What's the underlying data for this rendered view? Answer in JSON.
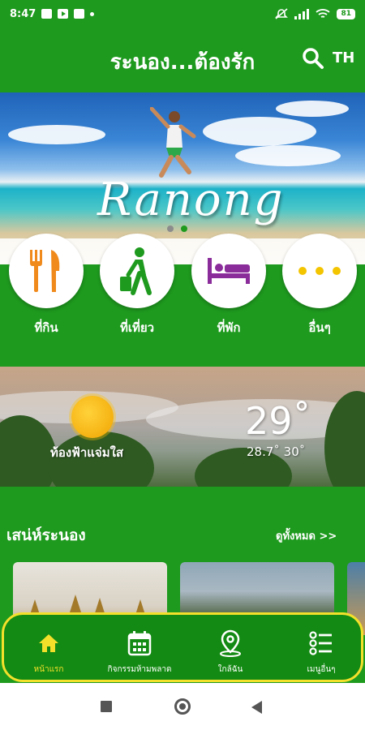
{
  "status_bar": {
    "time": "8:47",
    "battery": "81"
  },
  "header": {
    "title": "ระนอง...ต้องรัก",
    "lang": "TH"
  },
  "hero": {
    "title": "Ranong",
    "slide_index": 2,
    "slide_count": 2
  },
  "categories": [
    {
      "label": "ที่กิน",
      "icon": "fork-knife-icon",
      "color": "#f08a1c"
    },
    {
      "label": "ที่เที่ยว",
      "icon": "traveler-icon",
      "color": "#1e9a1e"
    },
    {
      "label": "ที่พัก",
      "icon": "bed-icon",
      "color": "#8a2c9a"
    },
    {
      "label": "อื่นๆ",
      "icon": "more-dots-icon",
      "color": "#f3c400"
    }
  ],
  "weather": {
    "description": "ท้องฟ้าแจ่มใส",
    "temp": "29˚",
    "range": "28.7˚ 30˚"
  },
  "section": {
    "title": "เสน่ห์ระนอง",
    "see_all": "ดูทั้งหมด >>"
  },
  "bottom_nav": [
    {
      "label": "หน้าแรก",
      "icon": "home-icon",
      "active": true
    },
    {
      "label": "กิจกรรมห้ามพลาด",
      "icon": "calendar-icon",
      "active": false
    },
    {
      "label": "ใกล้ฉัน",
      "icon": "location-pin-icon",
      "active": false
    },
    {
      "label": "เมนูอื่นๆ",
      "icon": "list-menu-icon",
      "active": false
    }
  ],
  "colors": {
    "primary": "#1e9a1e",
    "accent": "#f3e02b",
    "nav_bg": "#138a13"
  }
}
